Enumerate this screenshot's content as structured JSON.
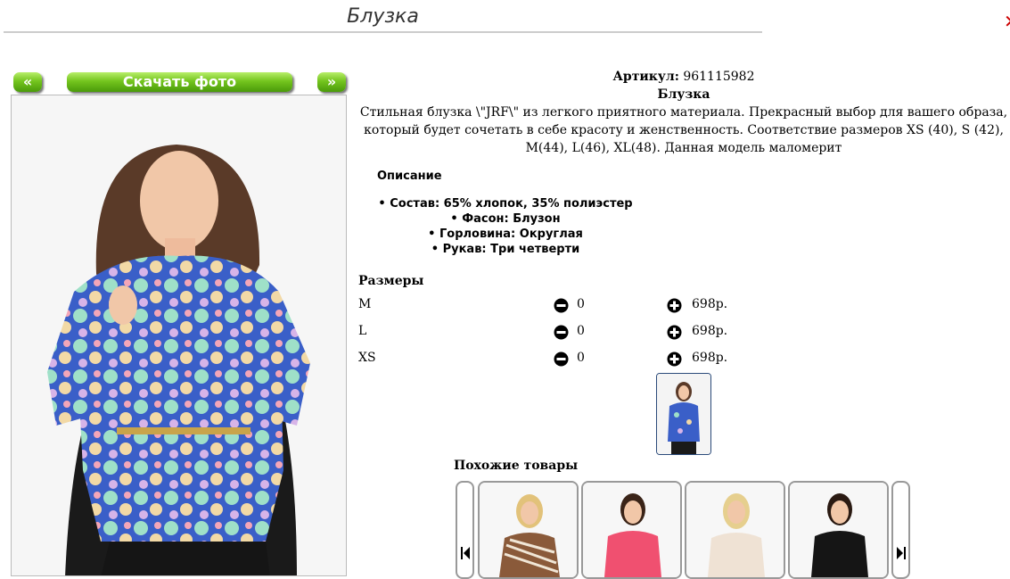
{
  "page": {
    "title": "Блузка"
  },
  "toolbar": {
    "prev_label": "«",
    "download_label": "Скачать фото",
    "next_label": "»"
  },
  "product": {
    "article_label": "Артикул:",
    "article_value": "961115982",
    "name": "Блузка",
    "description": "Стильная блузка \\\"JRF\\\" из легкого приятного материала. Прекрасный выбор для вашего образа, который будет сочетать в себе красоту и женственность. Соответствие размеров XS (40), S (42), M(44), L(46), XL(48). Данная модель маломерит"
  },
  "features": {
    "heading": "Описание",
    "items": [
      "Состав: 65% хлопок, 35% полиэстер",
      "Фасон: Блузон",
      "Горловина: Округлая",
      "Рукав: Три четверти"
    ]
  },
  "sizes": {
    "heading": "Размеры",
    "rows": [
      {
        "size": "M",
        "qty": "0",
        "price": "698р."
      },
      {
        "size": "L",
        "qty": "0",
        "price": "698р."
      },
      {
        "size": "XS",
        "qty": "0",
        "price": "698р."
      }
    ]
  },
  "similar": {
    "heading": "Похожие товары"
  },
  "colors": {
    "button_green": "#74c51e",
    "blouse_blue": "#3a5fc8",
    "close_red": "#cc0000"
  }
}
